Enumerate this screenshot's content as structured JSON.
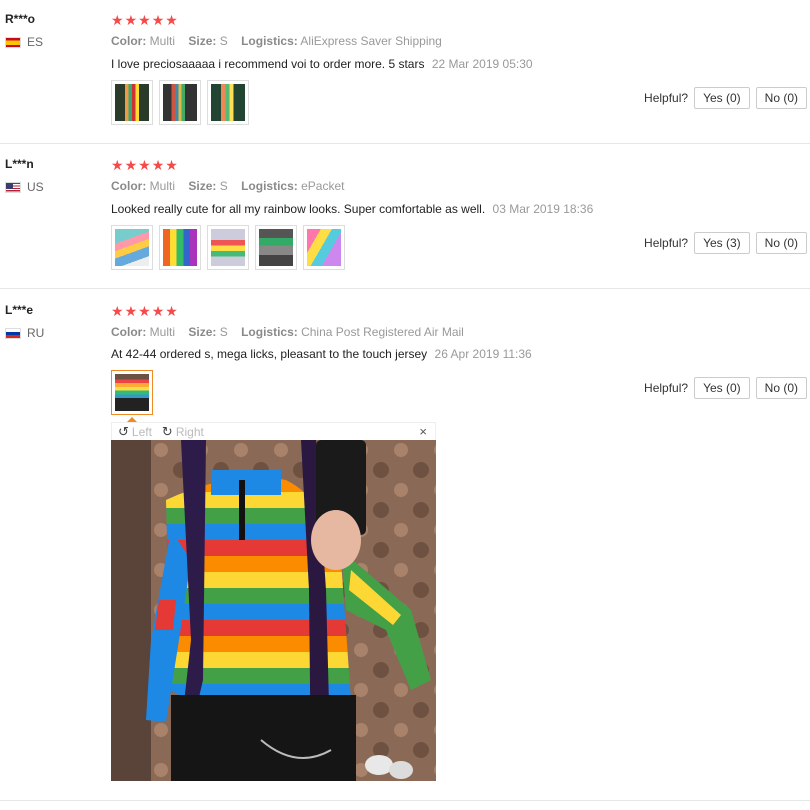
{
  "labels": {
    "color": "Color:",
    "size": "Size:",
    "logistics": "Logistics:",
    "helpful": "Helpful?"
  },
  "reviews": [
    {
      "user": "R***o",
      "country": "ES",
      "flag": "flag-es",
      "rating": 5,
      "color": "Multi",
      "size": "S",
      "logistics": "AliExpress Saver Shipping",
      "comment": "I love preciosaaaaa i recommend voi to order more. 5 stars",
      "date": "22 Mar 2019 05:30",
      "yes": "Yes (0)",
      "no": "No (0)"
    },
    {
      "user": "L***n",
      "country": "US",
      "flag": "flag-us",
      "rating": 5,
      "color": "Multi",
      "size": "S",
      "logistics": "ePacket",
      "comment": "Looked really cute for all my rainbow looks. Super comfortable as well.",
      "date": "03 Mar 2019 18:36",
      "yes": "Yes (3)",
      "no": "No (0)"
    },
    {
      "user": "L***e",
      "country": "RU",
      "flag": "flag-ru",
      "rating": 5,
      "color": "Multi",
      "size": "S",
      "logistics": "China Post Registered Air Mail",
      "comment": "At 42-44 ordered s, mega licks, pleasant to the touch jersey",
      "date": "26 Apr 2019 11:36",
      "yes": "Yes (0)",
      "no": "No (0)"
    }
  ],
  "viewer": {
    "rotate_left": "Left",
    "rotate_right": "Right",
    "close": "×"
  },
  "colors": {
    "star": "#f44a4a",
    "accent": "#f08a24"
  }
}
